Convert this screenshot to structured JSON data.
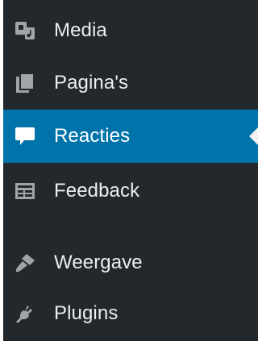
{
  "menu": {
    "items": [
      {
        "label": "Media",
        "icon": "media-icon"
      },
      {
        "label": "Pagina's",
        "icon": "pages-icon"
      },
      {
        "label": "Reacties",
        "icon": "comments-icon",
        "active": true
      },
      {
        "label": "Feedback",
        "icon": "feedback-icon"
      },
      {
        "label": "Weergave",
        "icon": "appearance-icon"
      },
      {
        "label": "Plugins",
        "icon": "plugins-icon"
      }
    ]
  },
  "colors": {
    "sidebar_bg": "#23282d",
    "active_bg": "#0073aa",
    "text": "#eeeeee",
    "icon": "#a0a5aa",
    "pointer": "#f1f1f1"
  }
}
